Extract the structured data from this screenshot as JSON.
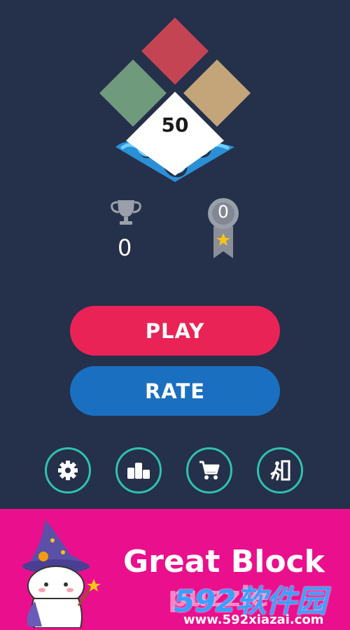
{
  "logo": {
    "score": "50"
  },
  "stats": {
    "best_score": "0",
    "medal_count": "0"
  },
  "buttons": {
    "play": "PLAY",
    "rate": "RATE"
  },
  "icons": [
    "gear-icon",
    "leaderboard-icon",
    "cart-icon",
    "exit-icon"
  ],
  "banner": {
    "title": "Great Block",
    "subtitle": "puzzle"
  },
  "watermark": {
    "brand": "592软件园",
    "url": "www.592xiazai.com"
  },
  "colors": {
    "background": "#25304a",
    "play": "#ea2356",
    "rate": "#1a6fc0",
    "ring": "#2fc2ad",
    "banner": "#ea0f8c",
    "tile_red": "#c44454",
    "tile_green": "#6f9a7c",
    "tile_tan": "#c4a57a"
  }
}
